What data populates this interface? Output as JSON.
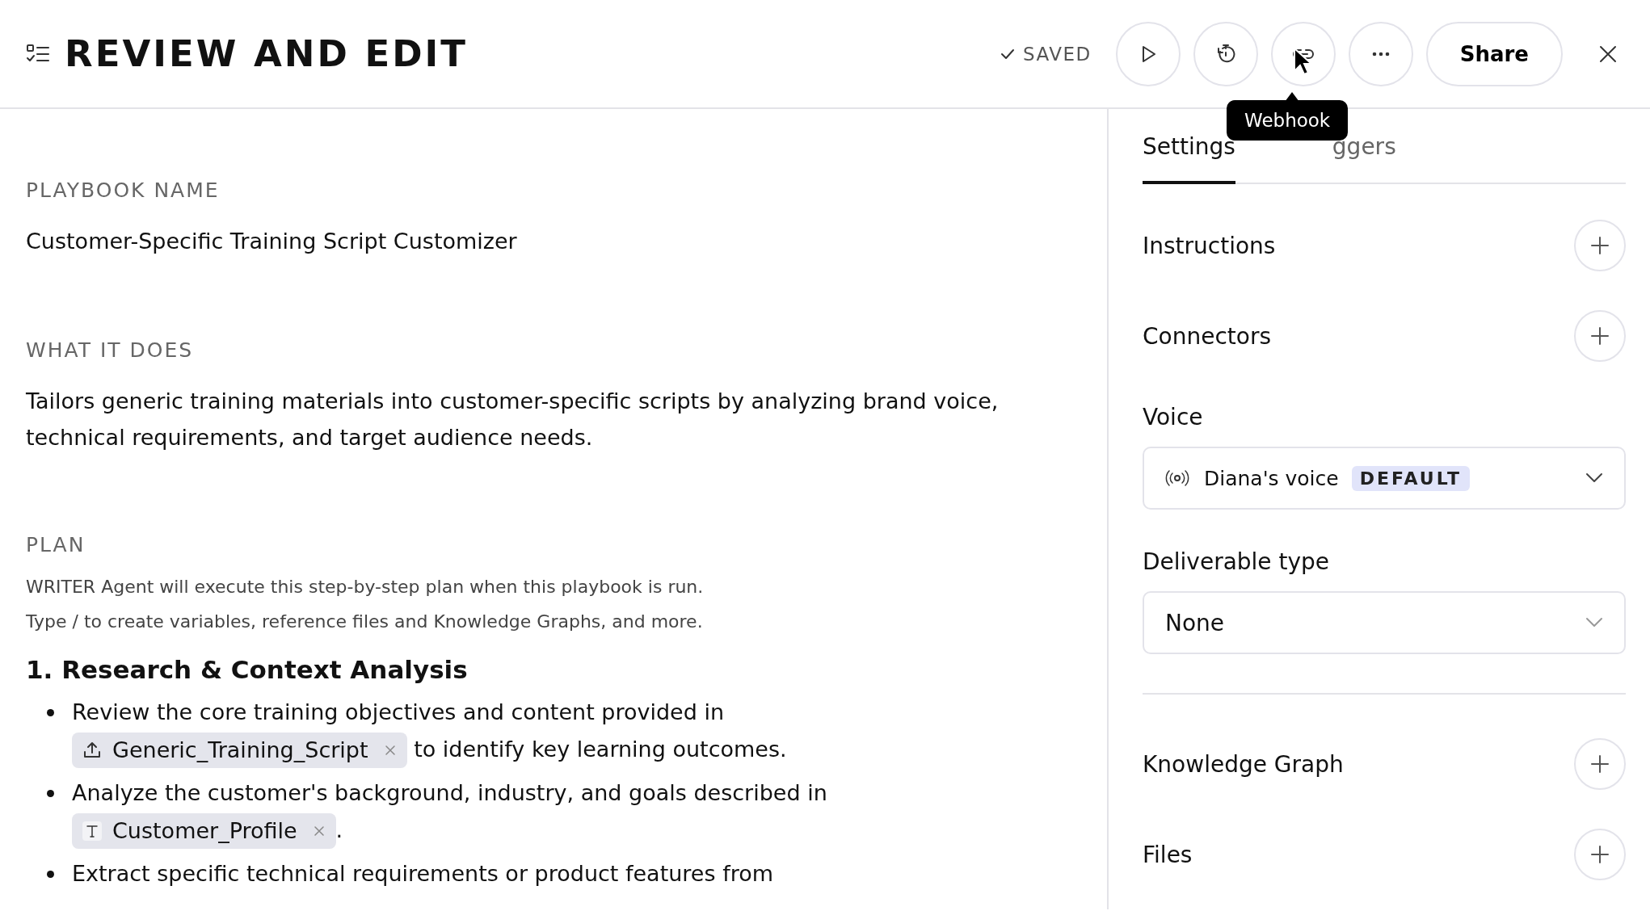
{
  "header": {
    "title": "REVIEW AND EDIT",
    "status": "SAVED",
    "share": "Share",
    "tooltip": "Webhook"
  },
  "editor": {
    "fields": [
      {
        "label": "PLAYBOOK NAME",
        "value": "Customer-Specific Training Script Customizer"
      },
      {
        "label": "WHAT IT DOES",
        "value": "Tailors generic training materials into customer-specific scripts by analyzing brand voice, technical requirements, and target audience needs."
      }
    ],
    "plan": {
      "label": "PLAN",
      "hints": [
        "WRITER Agent will execute this step-by-step plan when this playbook is run.",
        "Type / to create variables, reference files and Knowledge Graphs, and more."
      ],
      "steps": [
        {
          "title": "1. Research & Context Analysis",
          "bullets": [
            [
              {
                "kind": "text",
                "text": "Review the core training objectives and content provided in "
              },
              {
                "kind": "file",
                "text": "Generic_Training_Script"
              },
              {
                "kind": "text",
                "text": " to identify key learning outcomes."
              }
            ],
            [
              {
                "kind": "text",
                "text": "Analyze the customer's background, industry, and goals described in "
              },
              {
                "kind": "variable",
                "text": "Customer_Profile"
              },
              {
                "kind": "text",
                "text": "."
              }
            ],
            [
              {
                "kind": "text",
                "text": "Extract specific technical requirements or product features from"
              }
            ]
          ]
        }
      ]
    }
  },
  "panel": {
    "tabs": [
      {
        "label": "Settings",
        "selected": true
      },
      {
        "label": "ggers",
        "selected": false
      }
    ],
    "sections": [
      {
        "kind": "add",
        "label": "Instructions"
      },
      {
        "kind": "add",
        "label": "Connectors"
      },
      {
        "kind": "voice",
        "label": "Voice",
        "value": "Diana's voice",
        "badge": "DEFAULT"
      },
      {
        "kind": "select",
        "label": "Deliverable type",
        "value": "None"
      },
      {
        "kind": "divider"
      },
      {
        "kind": "add",
        "label": "Knowledge Graph"
      },
      {
        "kind": "add",
        "label": "Files"
      }
    ]
  }
}
